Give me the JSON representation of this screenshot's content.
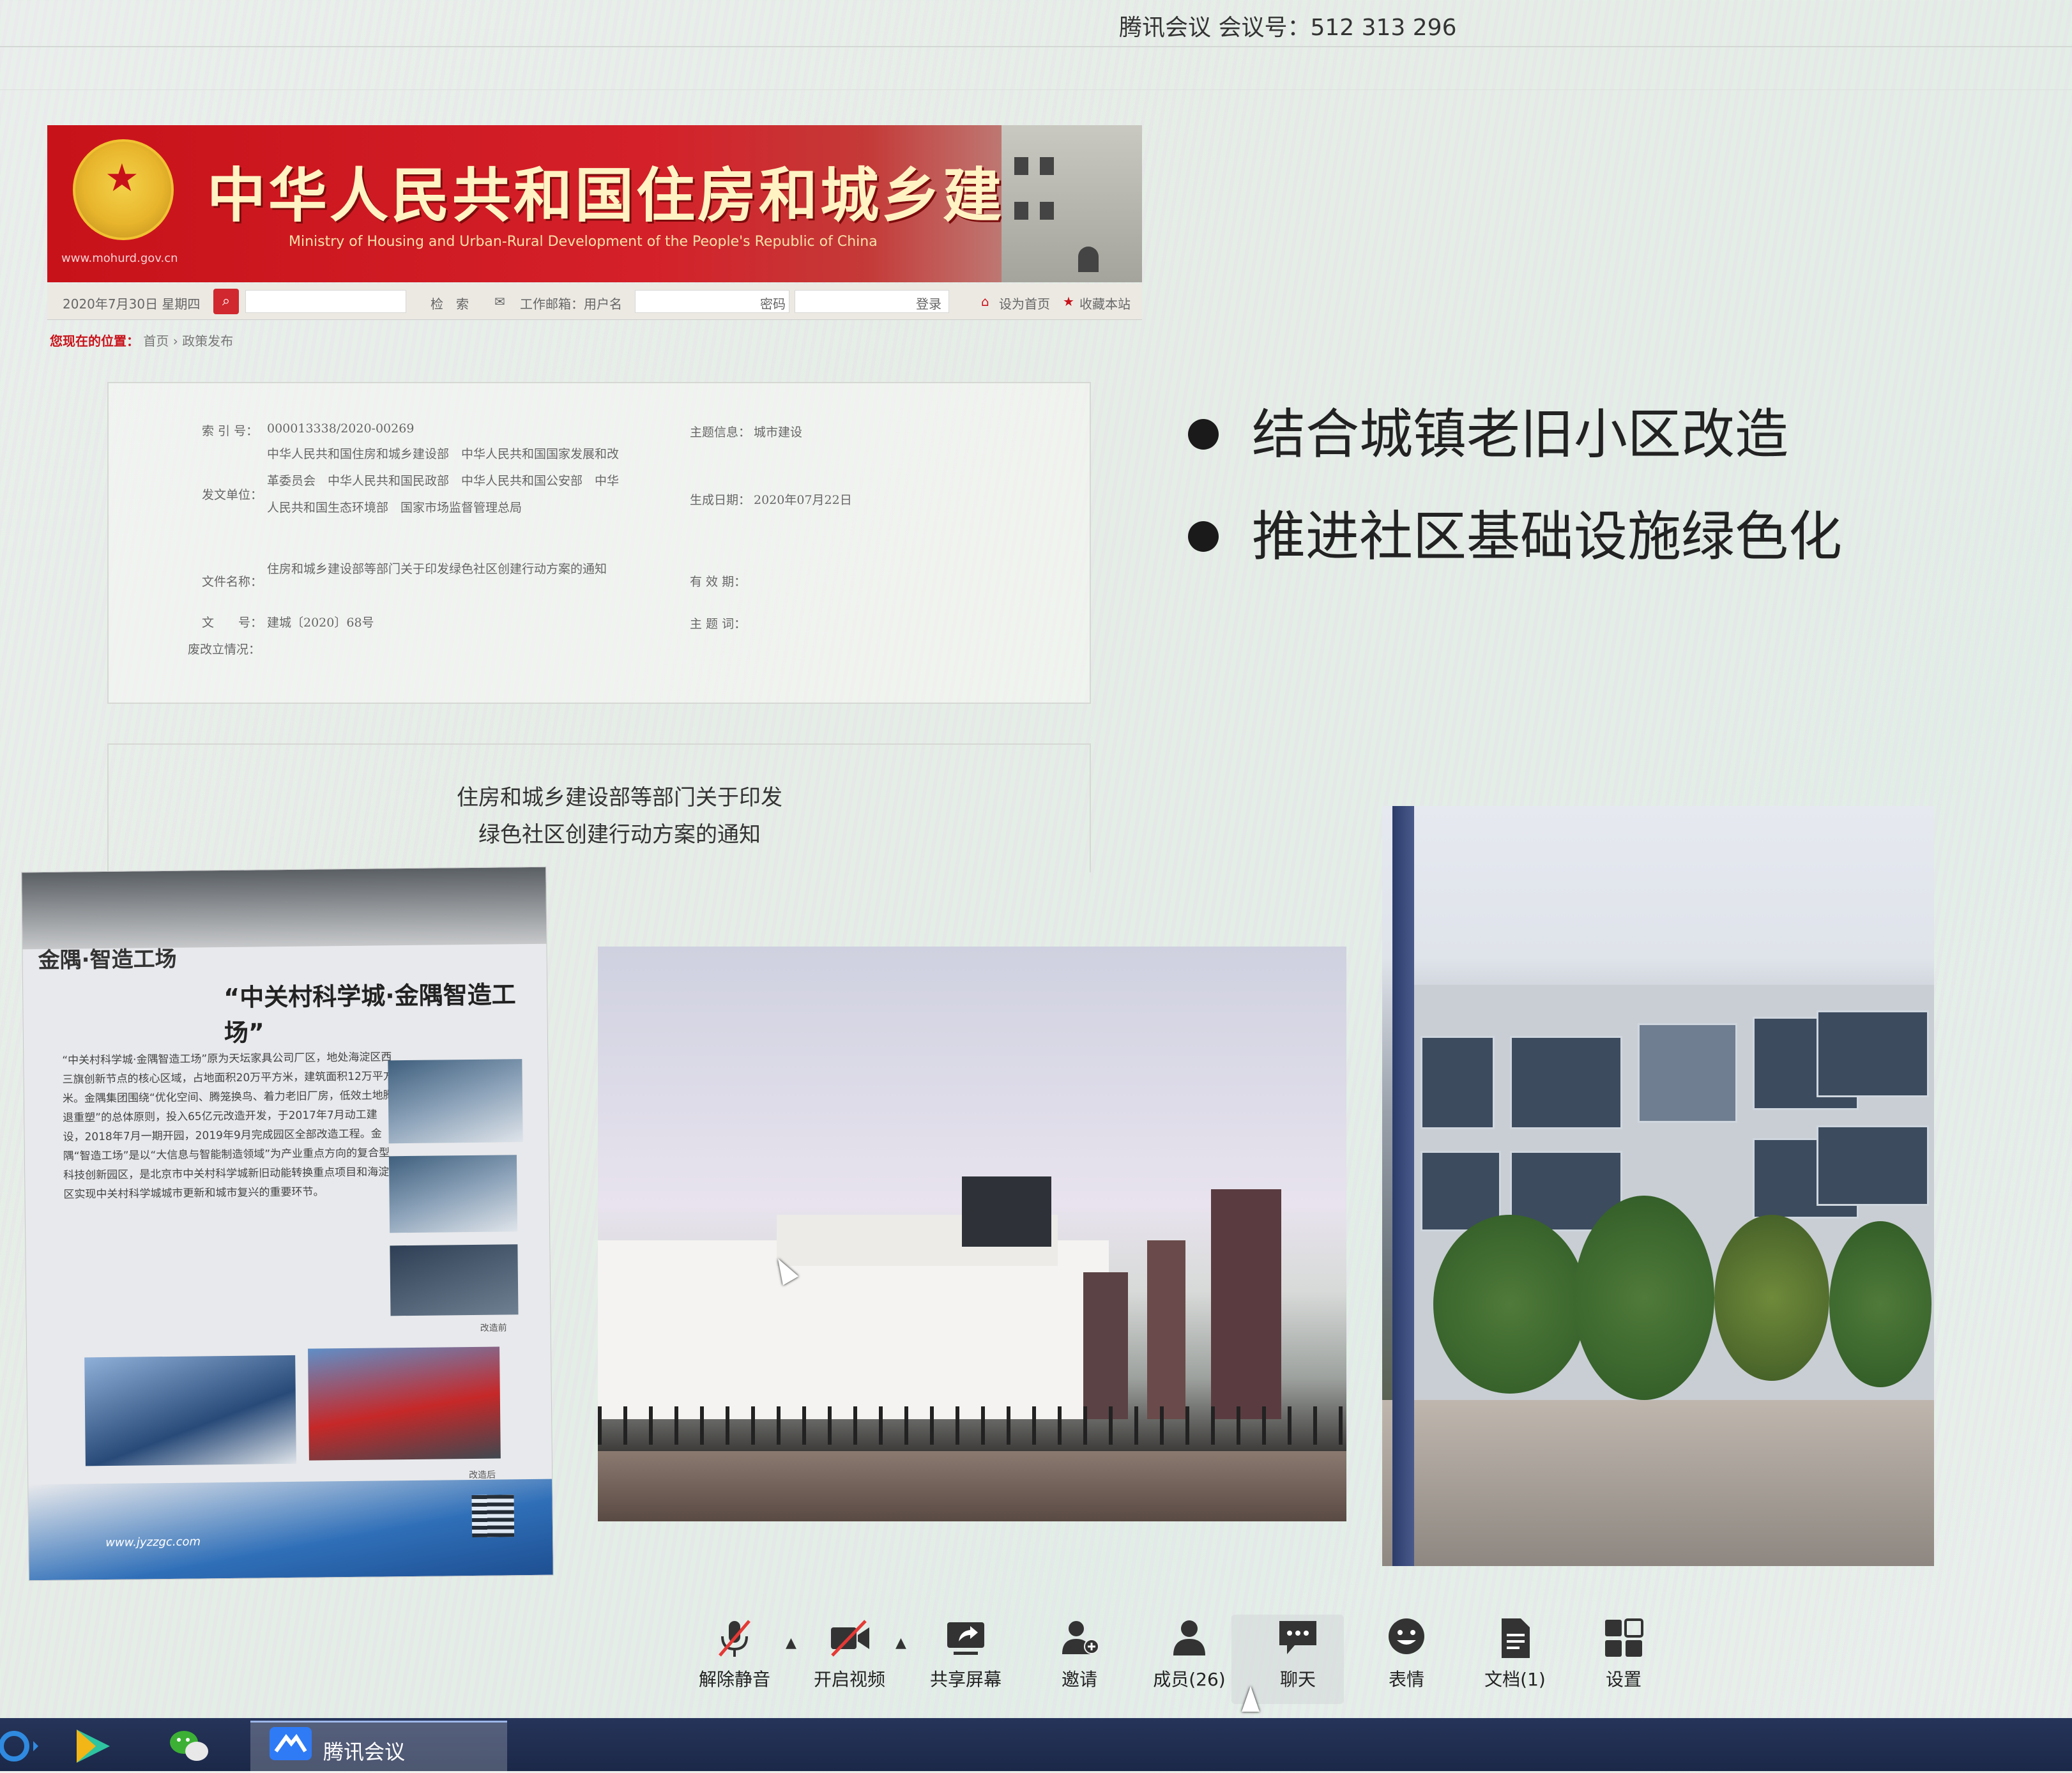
{
  "meeting": {
    "title": "腾讯会议 会议号：512 313 296"
  },
  "website": {
    "title": "中华人民共和国住房和城乡建设部",
    "subtitle_en": "Ministry of Housing and Urban-Rural Development of the People's Republic of China",
    "url": "www.mohurd.gov.cn",
    "date": "2020年7月30日 星期四",
    "search_button": "检　索",
    "email_label": "工作邮箱：用户名",
    "password_label": "密码",
    "login_button": "登录",
    "set_home": "设为首页",
    "bookmark": "收藏本站",
    "breadcrumb_prefix": "您现在的位置：",
    "breadcrumb_path": "首页 › 政策发布"
  },
  "document_info": {
    "index_label": "索 引 号：",
    "index_value": "000013338/2020-00269",
    "category_label": "主题信息：",
    "category_value": "城市建设",
    "issuer_label": "发文单位：",
    "issuer_value": "中华人民共和国住房和城乡建设部　中华人民共和国国家发展和改革委员会　中华人民共和国民政部　中华人民共和国公安部　中华人民共和国生态环境部　国家市场监督管理总局",
    "date_label": "生成日期：",
    "date_value": "2020年07月22日",
    "name_label": "文件名称：",
    "name_value": "住房和城乡建设部等部门关于印发绿色社区创建行动方案的通知",
    "validity_label": "有 效 期：",
    "number_label": "文　　号：",
    "number_value": "建城〔2020〕68号",
    "keywords_label": "主 题 词：",
    "status_label": "废改立情况："
  },
  "notice": {
    "line1": "住房和城乡建设部等部门关于印发",
    "line2": "绿色社区创建行动方案的通知"
  },
  "bullets": [
    "结合城镇老旧小区改造",
    "推进社区基础设施绿色化"
  ],
  "poster": {
    "brand": "金隅·智造工场",
    "title": "“中关村科学城·金隅智造工场”",
    "body": "“中关村科学城·金隅智造工场”原为天坛家具公司厂区，地处海淀区西三旗创新节点的核心区域，占地面积20万平方米，建筑面积12万平方米。金隅集团围绕“优化空间、腾笼换鸟、着力老旧厂房，低效土地腾退重塑”的总体原则，投入65亿元改造开发，于2017年7月动工建设，2018年7月一期开园，2019年9月完成园区全部改造工程。金隅“智造工场”是以“大信息与智能制造领域”为产业重点方向的复合型科技创新园区，是北京市中关村科学城新旧动能转换重点项目和海淀区实现中关村科学城城市更新和城市复兴的重要环节。",
    "caption_before": "改造前",
    "caption_after": "改造后",
    "url": "www.jyzzgc.com"
  },
  "toolbar": {
    "items": [
      {
        "label": "解除静音",
        "icon": "mic-muted-icon"
      },
      {
        "label": "开启视频",
        "icon": "video-off-icon"
      },
      {
        "label": "共享屏幕",
        "icon": "share-screen-icon"
      },
      {
        "label": "邀请",
        "icon": "invite-icon"
      },
      {
        "label": "成员(26)",
        "icon": "members-icon"
      },
      {
        "label": "聊天",
        "icon": "chat-icon"
      },
      {
        "label": "表情",
        "icon": "emoji-icon"
      },
      {
        "label": "文档(1)",
        "icon": "document-icon"
      },
      {
        "label": "设置",
        "icon": "settings-icon"
      }
    ]
  },
  "taskbar": {
    "active_app": "腾讯会议"
  },
  "colors": {
    "banner_red": "#c8121a",
    "banner_gold": "#fff3c4",
    "taskbar": "#1b2848"
  }
}
